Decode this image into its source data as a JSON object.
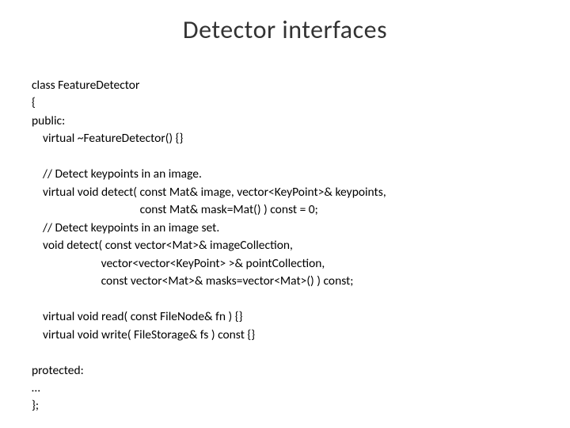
{
  "title": "Detector interfaces",
  "code": {
    "line1": "class FeatureDetector",
    "line2": "{",
    "line3": "public:",
    "line4": "    virtual ~FeatureDetector() {}",
    "line5": "",
    "line6": "    // Detect keypoints in an image.",
    "line7": "    virtual void detect( const Mat& image, vector<KeyPoint>& keypoints,",
    "line8": "                                       const Mat& mask=Mat() ) const = 0;",
    "line9": "    // Detect keypoints in an image set.",
    "line10": "    void detect( const vector<Mat>& imageCollection,",
    "line11": "                         vector<vector<KeyPoint> >& pointCollection,",
    "line12": "                         const vector<Mat>& masks=vector<Mat>() ) const;",
    "line13": "",
    "line14": "    virtual void read( const FileNode& fn ) {}",
    "line15": "    virtual void write( FileStorage& fs ) const {}",
    "line16": "",
    "line17": "protected:",
    "line18": "…",
    "line19": "};"
  }
}
